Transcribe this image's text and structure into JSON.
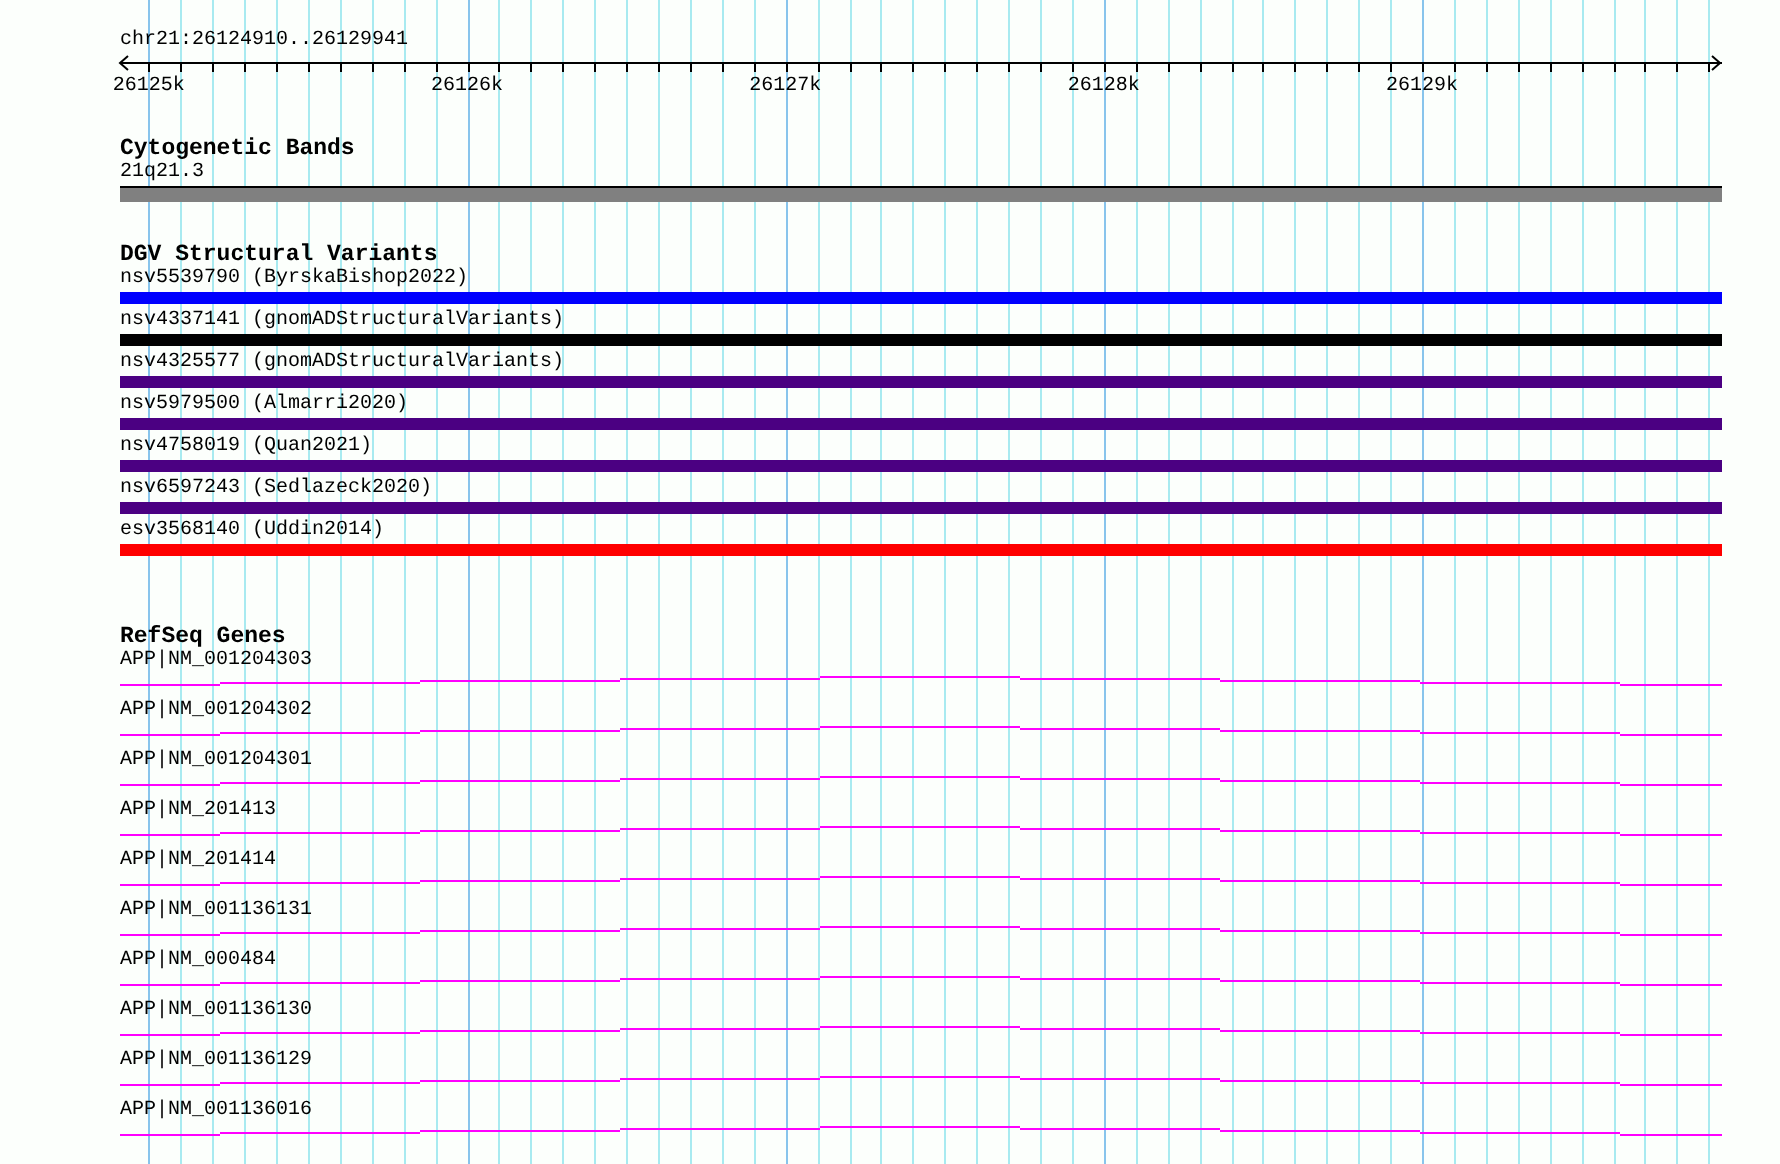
{
  "location": "chr21:26124910..26129941",
  "ruler": {
    "ticks": [
      "26125k",
      "26126k",
      "26127k",
      "26128k",
      "26129k"
    ]
  },
  "tracks": [
    {
      "kind": "bands",
      "title": "Cytogenetic Bands",
      "features": [
        {
          "label": "21q21.3"
        }
      ]
    },
    {
      "kind": "variants",
      "title": "DGV Structural Variants",
      "features": [
        {
          "label": "nsv5539790 (ByrskaBishop2022)",
          "color": "#0000ff"
        },
        {
          "label": "nsv4337141 (gnomADStructuralVariants)",
          "color": "#000000"
        },
        {
          "label": "nsv4325577 (gnomADStructuralVariants)",
          "color": "#4b0082"
        },
        {
          "label": "nsv5979500 (Almarri2020)",
          "color": "#4b0082"
        },
        {
          "label": "nsv4758019 (Quan2021)",
          "color": "#4b0082"
        },
        {
          "label": "nsv6597243 (Sedlazeck2020)",
          "color": "#4b0082"
        },
        {
          "label": "esv3568140 (Uddin2014)",
          "color": "#ff0000"
        }
      ]
    },
    {
      "kind": "genes",
      "title": "RefSeq Genes",
      "features": [
        {
          "label": "APP|NM_001204303"
        },
        {
          "label": "APP|NM_001204302"
        },
        {
          "label": "APP|NM_001204301"
        },
        {
          "label": "APP|NM_201413"
        },
        {
          "label": "APP|NM_201414"
        },
        {
          "label": "APP|NM_001136131"
        },
        {
          "label": "APP|NM_000484"
        },
        {
          "label": "APP|NM_001136130"
        },
        {
          "label": "APP|NM_001136129"
        },
        {
          "label": "APP|NM_001136016"
        }
      ]
    }
  ]
}
